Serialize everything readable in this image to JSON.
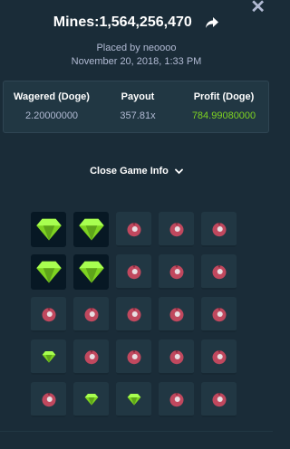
{
  "title": "Mines:1,564,256,470",
  "placed_by": "Placed by neoooo",
  "date": "November 20, 2018, 1:33 PM",
  "stats": {
    "wagered_label": "Wagered (Doge)",
    "wagered_value": "2.20000000",
    "payout_label": "Payout",
    "payout_value": "357.81x",
    "profit_label": "Profit (Doge)",
    "profit_value": "784.99080000"
  },
  "toggle_label": "Close Game Info",
  "colors": {
    "profit": "#7ed321",
    "gem": "#7ed321",
    "mine": "#c0485e"
  },
  "board": [
    [
      "gem-selected",
      "gem-selected",
      "mine",
      "mine",
      "mine"
    ],
    [
      "gem-selected",
      "gem-selected",
      "mine",
      "mine",
      "mine"
    ],
    [
      "mine",
      "mine",
      "mine",
      "mine",
      "mine"
    ],
    [
      "gem",
      "mine",
      "mine",
      "mine",
      "mine"
    ],
    [
      "mine",
      "gem",
      "gem",
      "mine",
      "mine"
    ]
  ]
}
